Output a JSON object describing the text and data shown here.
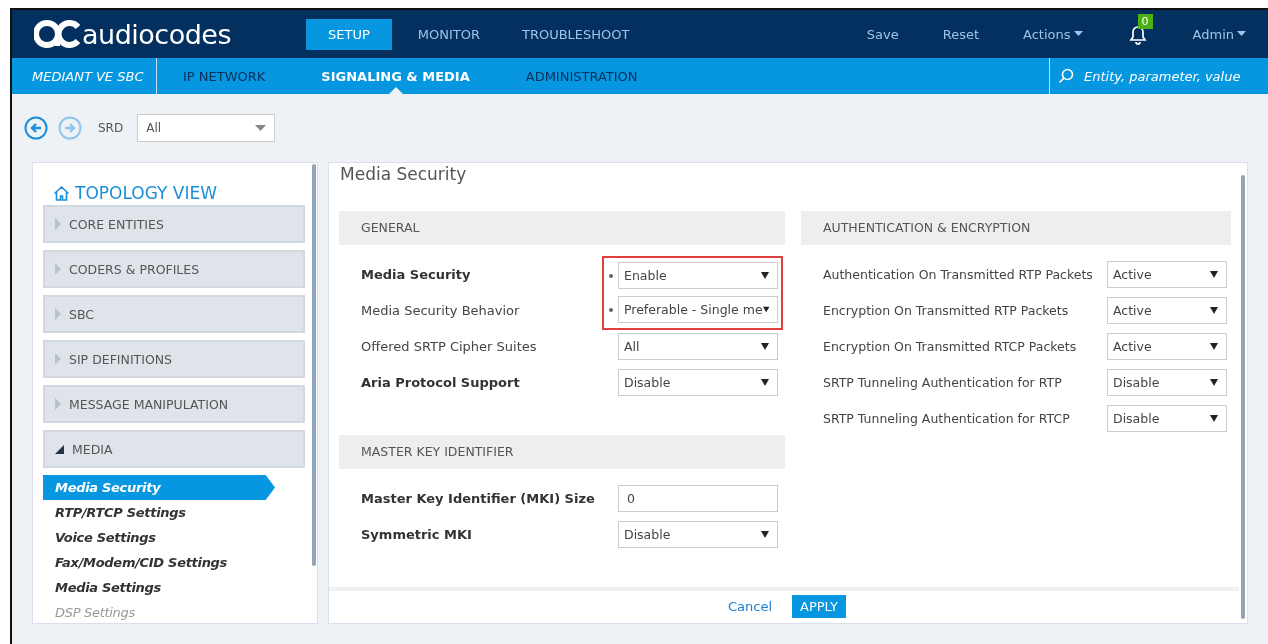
{
  "header": {
    "logo": "audiocodes",
    "tabs": [
      {
        "label": "SETUP",
        "selected": true
      },
      {
        "label": "MONITOR",
        "selected": false
      },
      {
        "label": "TROUBLESHOOT",
        "selected": false
      }
    ],
    "actions": [
      {
        "kind": "link",
        "label": "Save"
      },
      {
        "kind": "link",
        "label": "Reset"
      },
      {
        "kind": "menu",
        "label": "Actions"
      },
      {
        "kind": "bell",
        "badge": "0"
      },
      {
        "kind": "menu",
        "label": "Admin"
      }
    ]
  },
  "subnav": {
    "device": "MEDIANT VE SBC",
    "tabs": [
      {
        "label": "IP NETWORK",
        "selected": false
      },
      {
        "label": "SIGNALING & MEDIA",
        "selected": true
      },
      {
        "label": "ADMINISTRATION",
        "selected": false
      }
    ],
    "search": {
      "placeholder": "Entity, parameter, value"
    }
  },
  "toolbar": {
    "srd_label": "SRD",
    "srd_value": "All"
  },
  "sidebar": {
    "title": "TOPOLOGY VIEW",
    "groups": [
      {
        "label": "CORE ENTITIES",
        "expanded": false
      },
      {
        "label": "CODERS & PROFILES",
        "expanded": false
      },
      {
        "label": "SBC",
        "expanded": false
      },
      {
        "label": "SIP DEFINITIONS",
        "expanded": false
      },
      {
        "label": "MESSAGE MANIPULATION",
        "expanded": false
      },
      {
        "label": "MEDIA",
        "expanded": true,
        "children": [
          {
            "label": "Media Security",
            "selected": true,
            "disabled": false
          },
          {
            "label": "RTP/RTCP Settings",
            "selected": false,
            "disabled": false
          },
          {
            "label": "Voice Settings",
            "selected": false,
            "disabled": false
          },
          {
            "label": "Fax/Modem/CID Settings",
            "selected": false,
            "disabled": false
          },
          {
            "label": "Media Settings",
            "selected": false,
            "disabled": false
          },
          {
            "label": "DSP Settings",
            "selected": false,
            "disabled": true
          }
        ]
      }
    ]
  },
  "panel": {
    "title": "Media Security",
    "columns": [
      {
        "sections": [
          {
            "title": "GENERAL",
            "fields": [
              {
                "label": "Media Security",
                "kind": "select",
                "value": "Enable",
                "modified": true,
                "dot": true,
                "highlighted": true
              },
              {
                "label": "Media Security Behavior",
                "kind": "select",
                "value": "Preferable - Single me",
                "modified": false,
                "dot": true,
                "highlighted": true
              },
              {
                "label": "Offered SRTP Cipher Suites",
                "kind": "select",
                "value": "All",
                "modified": false,
                "dot": false,
                "highlighted": false
              },
              {
                "label": "Aria Protocol Support",
                "kind": "select",
                "value": "Disable",
                "modified": true,
                "dot": false,
                "highlighted": false
              }
            ]
          },
          {
            "title": "MASTER KEY IDENTIFIER",
            "fields": [
              {
                "label": "Master Key Identifier (MKI) Size",
                "kind": "text",
                "value": "0",
                "modified": true,
                "dot": false,
                "highlighted": false
              },
              {
                "label": "Symmetric MKI",
                "kind": "select",
                "value": "Disable",
                "modified": true,
                "dot": false,
                "highlighted": false
              }
            ]
          }
        ]
      },
      {
        "sections": [
          {
            "title": "AUTHENTICATION & ENCRYPTION",
            "fields": [
              {
                "label": "Authentication On Transmitted RTP Packets",
                "kind": "select",
                "value": "Active",
                "modified": false,
                "dot": false,
                "highlighted": false
              },
              {
                "label": "Encryption On Transmitted RTP Packets",
                "kind": "select",
                "value": "Active",
                "modified": false,
                "dot": false,
                "highlighted": false
              },
              {
                "label": "Encryption On Transmitted RTCP Packets",
                "kind": "select",
                "value": "Active",
                "modified": false,
                "dot": false,
                "highlighted": false
              },
              {
                "label": "SRTP Tunneling Authentication for RTP",
                "kind": "select",
                "value": "Disable",
                "modified": false,
                "dot": false,
                "highlighted": false
              },
              {
                "label": "SRTP Tunneling Authentication for RTCP",
                "kind": "select",
                "value": "Disable",
                "modified": false,
                "dot": false,
                "highlighted": false
              }
            ]
          }
        ]
      }
    ],
    "buttons": [
      {
        "kind": "link",
        "label": "Cancel"
      },
      {
        "kind": "primary",
        "label": "APPLY"
      }
    ]
  }
}
